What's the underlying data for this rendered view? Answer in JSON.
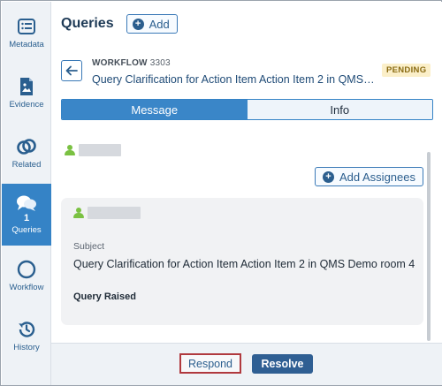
{
  "sidebar": {
    "items": [
      {
        "label": "Metadata",
        "icon": "metadata-icon"
      },
      {
        "label": "Evidence",
        "icon": "evidence-icon"
      },
      {
        "label": "Related",
        "icon": "link-icon"
      },
      {
        "label": "Queries",
        "icon": "chat-icon",
        "count": "1",
        "active": true
      },
      {
        "label": "Workflow",
        "icon": "circle-icon"
      },
      {
        "label": "History",
        "icon": "history-icon"
      }
    ]
  },
  "header": {
    "title": "Queries",
    "add_label": "Add"
  },
  "workflow": {
    "prefix": "WORKFLOW",
    "number": "3303",
    "title": "Query Clarification for Action Item Action Item 2 in QMS Demo room 4",
    "status": "PENDING"
  },
  "tabs": [
    {
      "label": "Message",
      "active": true
    },
    {
      "label": "Info",
      "active": false
    }
  ],
  "content": {
    "add_assignees_label": "Add Assignees",
    "card": {
      "subject_label": "Subject",
      "subject": "Query Clarification for Action Item Action Item 2 in QMS Demo room 4",
      "status": "Query Raised"
    }
  },
  "footer": {
    "respond_label": "Respond",
    "resolve_label": "Resolve"
  },
  "colors": {
    "accent": "#3583c6",
    "primary_dark": "#2f5f93",
    "pending_bg": "#fbefc9",
    "user_green": "#7ac142",
    "highlight_red": "#b0393e"
  }
}
